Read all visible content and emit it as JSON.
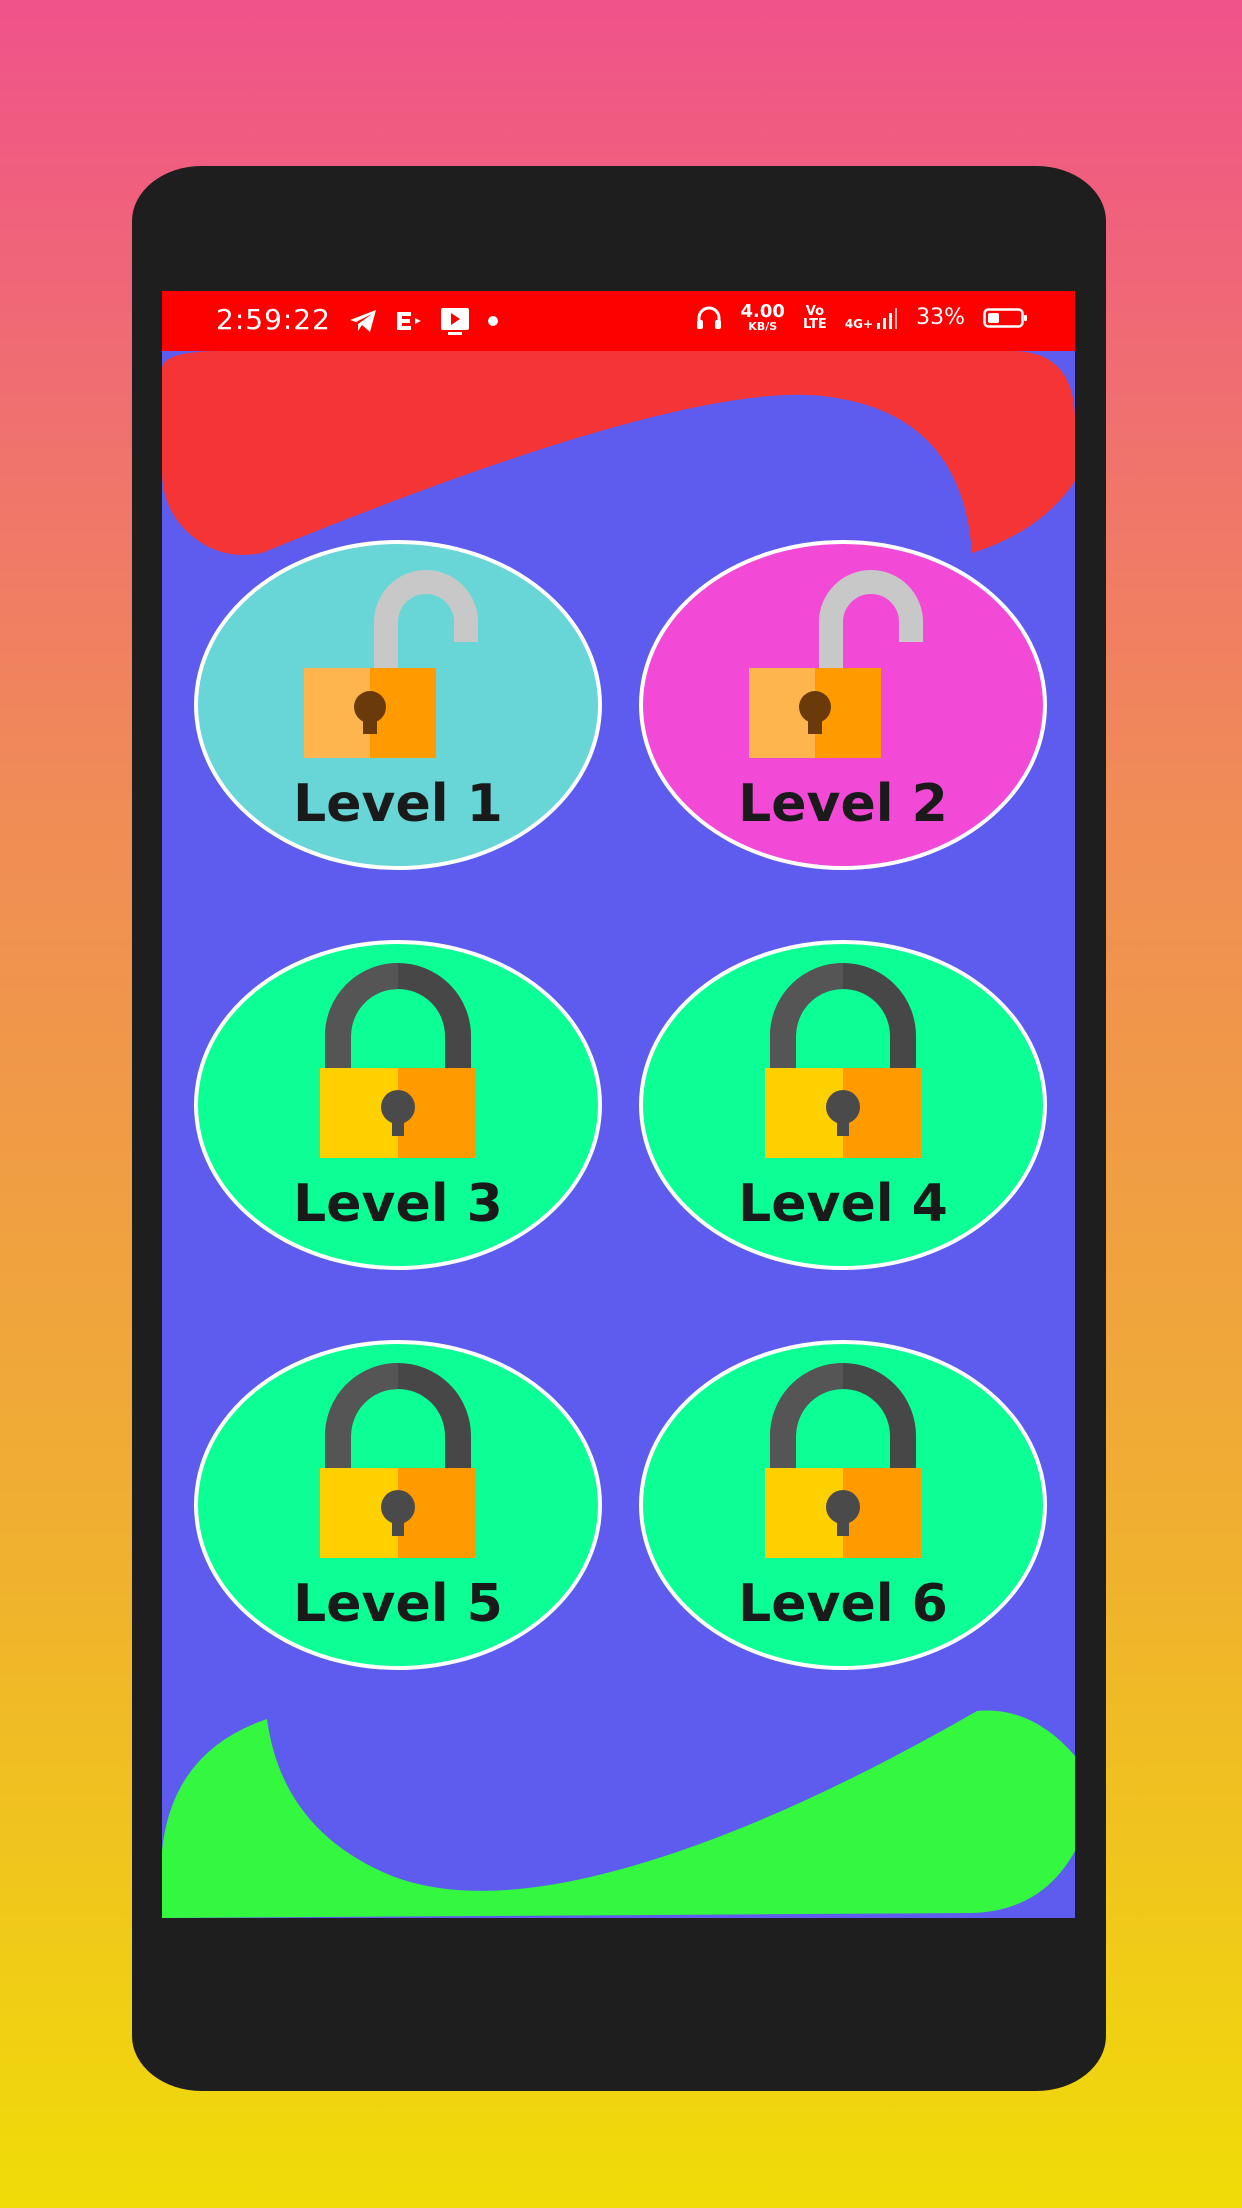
{
  "status_bar": {
    "time": "2:59:22",
    "speed_value": "4.00",
    "speed_unit": "KB/S",
    "volte_top": "Vo",
    "volte_bottom": "LTE",
    "network": "4G+",
    "battery_percent": "33%",
    "battery_level": 0.33,
    "left_icons": [
      "telegram-icon",
      "e-app-icon",
      "video-player-icon",
      "dot-icon"
    ],
    "right_icons": [
      "headphones-icon",
      "signal-icon",
      "battery-icon"
    ]
  },
  "levels": [
    {
      "label": "Level 1",
      "state": "unlocked",
      "color": "#68d6d6"
    },
    {
      "label": "Level 2",
      "state": "unlocked",
      "color": "#f24ad6"
    },
    {
      "label": "Level 3",
      "state": "locked",
      "color": "#0bff95"
    },
    {
      "label": "Level 4",
      "state": "locked",
      "color": "#0bff95"
    },
    {
      "label": "Level 5",
      "state": "locked",
      "color": "#0bff95"
    },
    {
      "label": "Level 6",
      "state": "locked",
      "color": "#0bff95"
    }
  ],
  "colors": {
    "screen_bg": "#5e5cee",
    "status_bar": "#fd0000",
    "top_wave": "#f53535",
    "bottom_wave": "#34f83f",
    "phone_frame": "#1e1e1e"
  }
}
